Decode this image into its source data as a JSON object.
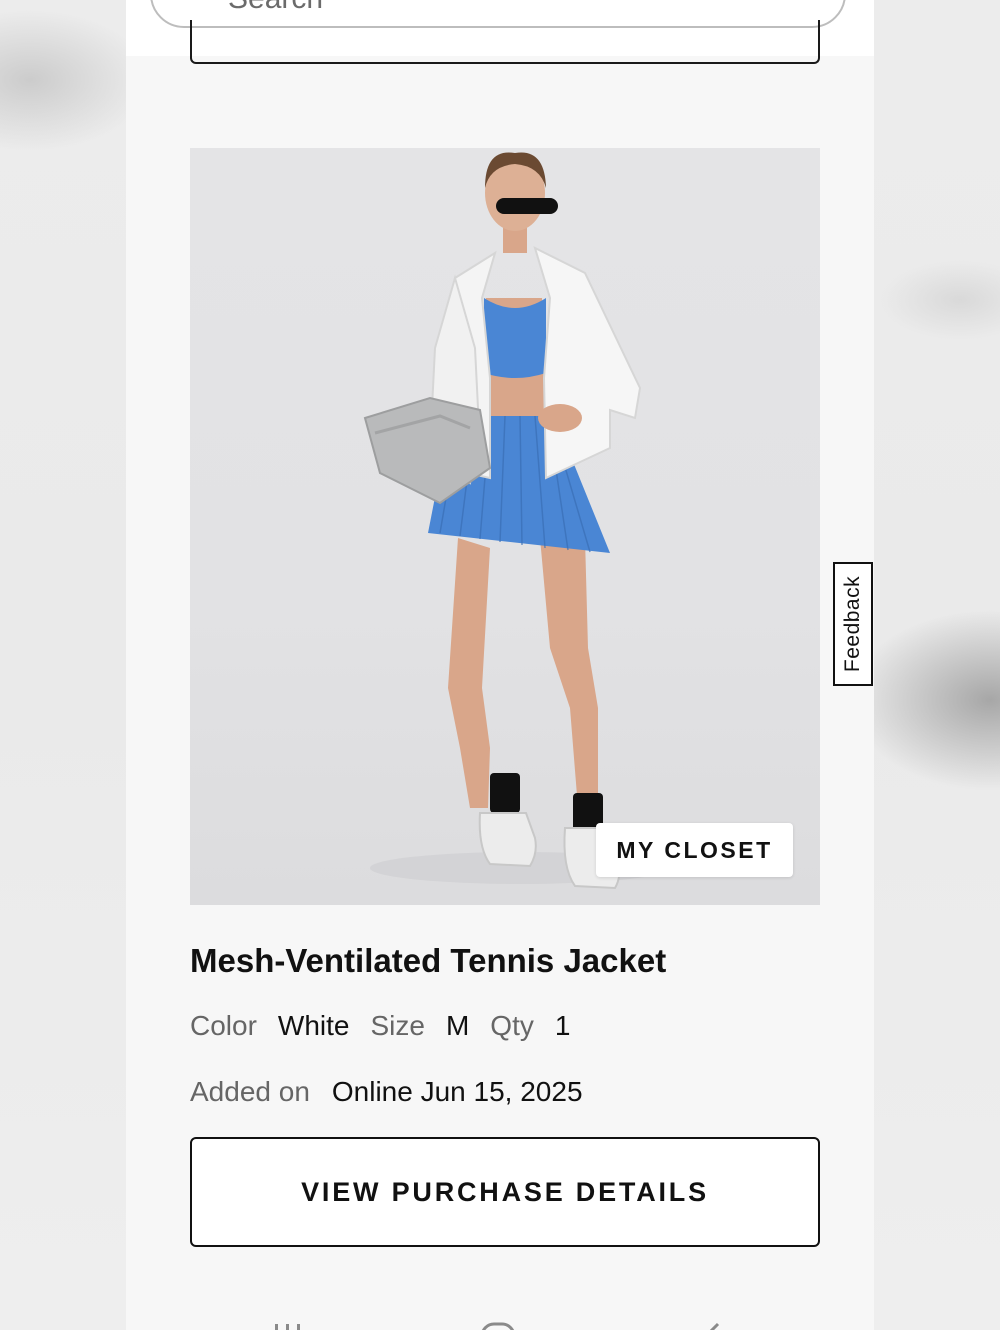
{
  "search": {
    "placeholder": "Search"
  },
  "product": {
    "title": "Mesh-Ventilated Tennis Jacket",
    "image_alt": "Model wearing white tennis jacket with blue bra top and pleated skirt",
    "badge": "MY CLOSET",
    "details": {
      "color_label": "Color",
      "color_value": "White",
      "size_label": "Size",
      "size_value": "M",
      "qty_label": "Qty",
      "qty_value": "1"
    },
    "added": {
      "label": "Added on",
      "value": "Online Jun 15, 2025"
    },
    "button_label": "VIEW PURCHASE DETAILS"
  },
  "feedback": {
    "label": "Feedback"
  },
  "nav": {
    "icons": [
      "recent-apps-icon",
      "home-icon",
      "back-icon"
    ]
  },
  "colors": {
    "accent_blue": "#4a86d4",
    "jacket_white": "#f4f4f4",
    "text_primary": "#111111",
    "text_secondary": "#666666"
  }
}
